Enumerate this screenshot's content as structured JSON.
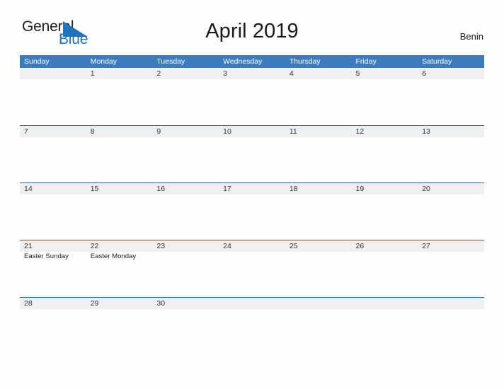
{
  "brand": {
    "word_one": "General",
    "word_two": "Blue",
    "triangle_color": "#1f74bb",
    "general_color": "#231f20",
    "blue_color": "#1f74bb"
  },
  "header": {
    "title": "April 2019",
    "country": "Benin"
  },
  "colors": {
    "header_band": "#3b7cbc",
    "row_rule": "#2e6da4",
    "day_number_band": "#efefef",
    "page_background": "#fdfdfd",
    "text": "#333333"
  },
  "calendar": {
    "weekday_headers": [
      "Sunday",
      "Monday",
      "Tuesday",
      "Wednesday",
      "Thursday",
      "Friday",
      "Saturday"
    ],
    "weeks": [
      [
        {
          "date": "",
          "events": []
        },
        {
          "date": "1",
          "events": []
        },
        {
          "date": "2",
          "events": []
        },
        {
          "date": "3",
          "events": []
        },
        {
          "date": "4",
          "events": []
        },
        {
          "date": "5",
          "events": []
        },
        {
          "date": "6",
          "events": []
        }
      ],
      [
        {
          "date": "7",
          "events": []
        },
        {
          "date": "8",
          "events": []
        },
        {
          "date": "9",
          "events": []
        },
        {
          "date": "10",
          "events": []
        },
        {
          "date": "11",
          "events": []
        },
        {
          "date": "12",
          "events": []
        },
        {
          "date": "13",
          "events": []
        }
      ],
      [
        {
          "date": "14",
          "events": []
        },
        {
          "date": "15",
          "events": []
        },
        {
          "date": "16",
          "events": []
        },
        {
          "date": "17",
          "events": []
        },
        {
          "date": "18",
          "events": []
        },
        {
          "date": "19",
          "events": []
        },
        {
          "date": "20",
          "events": []
        }
      ],
      [
        {
          "date": "21",
          "events": [
            "Easter Sunday"
          ]
        },
        {
          "date": "22",
          "events": [
            "Easter Monday"
          ]
        },
        {
          "date": "23",
          "events": []
        },
        {
          "date": "24",
          "events": []
        },
        {
          "date": "25",
          "events": []
        },
        {
          "date": "26",
          "events": []
        },
        {
          "date": "27",
          "events": []
        }
      ],
      [
        {
          "date": "28",
          "events": []
        },
        {
          "date": "29",
          "events": []
        },
        {
          "date": "30",
          "events": []
        },
        {
          "date": "",
          "events": []
        },
        {
          "date": "",
          "events": []
        },
        {
          "date": "",
          "events": []
        },
        {
          "date": "",
          "events": []
        }
      ]
    ]
  }
}
